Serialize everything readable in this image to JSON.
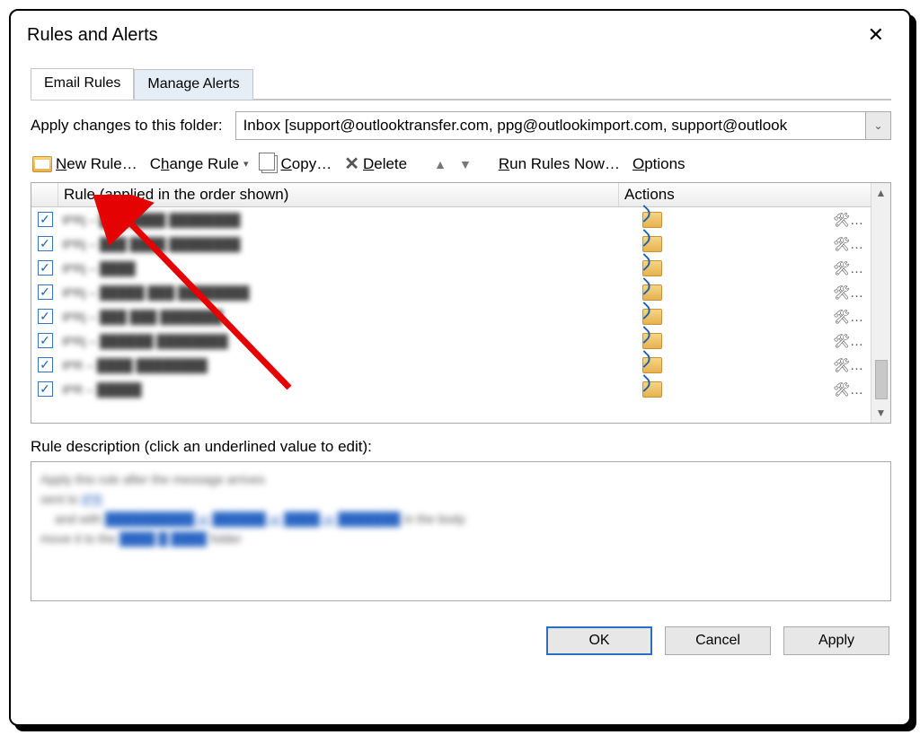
{
  "window": {
    "title": "Rules and Alerts"
  },
  "tabs": {
    "email_rules": "Email Rules",
    "manage_alerts": "Manage Alerts"
  },
  "folder": {
    "label": "Apply changes to this folder:",
    "value": "Inbox [support@outlooktransfer.com, ppg@outlookimport.com, support@outlook"
  },
  "toolbar": {
    "new_rule": "New Rule…",
    "change_rule": "Change Rule",
    "copy": "Copy…",
    "delete": "Delete",
    "run_rules": "Run Rules Now…",
    "options": "Options"
  },
  "headers": {
    "rule": "Rule (applied in the order shown)",
    "actions": "Actions"
  },
  "rules": [
    {
      "checked": true,
      "name": "IPRj – ███ ████ ████████"
    },
    {
      "checked": true,
      "name": "IPRj – ███ ████ ████████"
    },
    {
      "checked": true,
      "name": "IPRj – ████"
    },
    {
      "checked": true,
      "name": "IPRj – █████ ███ ████████"
    },
    {
      "checked": true,
      "name": "IPRj – ███ ███ ███████"
    },
    {
      "checked": true,
      "name": "IPRj – ██████ ████████"
    },
    {
      "checked": true,
      "name": "IPR – ████ ████████"
    },
    {
      "checked": true,
      "name": "IPR – █████"
    }
  ],
  "description": {
    "label": "Rule description (click an underlined value to edit):",
    "line1": "Apply this rule after the message arrives",
    "line2a": "sent to ",
    "line2b": "IPR",
    "line3a": "and with ",
    "line3b": "██████████ or ██████ or ████ or ███████",
    "line3c": " in the body",
    "line4a": "move it to the ",
    "line4b": "████ █ ████",
    "line4c": " folder"
  },
  "buttons": {
    "ok": "OK",
    "cancel": "Cancel",
    "apply": "Apply"
  }
}
